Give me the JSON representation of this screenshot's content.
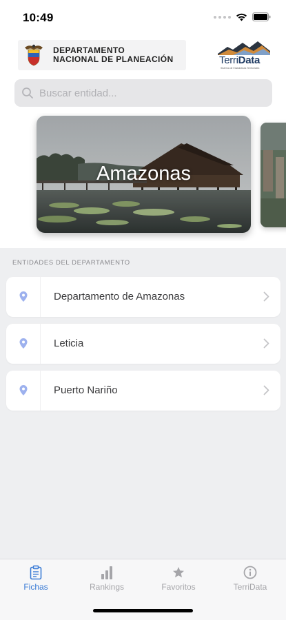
{
  "status_bar": {
    "time": "10:49"
  },
  "header": {
    "dnp_logo": {
      "line1": "DEPARTAMENTO",
      "line2": "NACIONAL DE PLANEACIÓN"
    },
    "terridata_logo": {
      "prefix": "Terri",
      "suffix": "Data",
      "tagline": "Sistema de Estadísticas Territoriales"
    }
  },
  "search": {
    "placeholder": "Buscar entidad..."
  },
  "carousel": {
    "cards": [
      {
        "title": "Amazonas"
      }
    ]
  },
  "section": {
    "label": "ENTIDADES DEL DEPARTAMENTO"
  },
  "entities": [
    {
      "label": "Departamento de Amazonas"
    },
    {
      "label": "Leticia"
    },
    {
      "label": "Puerto Nariño"
    }
  ],
  "tab_bar": {
    "tabs": [
      {
        "label": "Fichas",
        "icon": "clipboard-icon",
        "active": true
      },
      {
        "label": "Rankings",
        "icon": "bar-chart-icon",
        "active": false
      },
      {
        "label": "Favoritos",
        "icon": "star-icon",
        "active": false
      },
      {
        "label": "TerriData",
        "icon": "info-icon",
        "active": false
      }
    ]
  },
  "colors": {
    "accent": "#3a7bd5",
    "pin": "#9db1ee",
    "background": "#eeeff1"
  }
}
